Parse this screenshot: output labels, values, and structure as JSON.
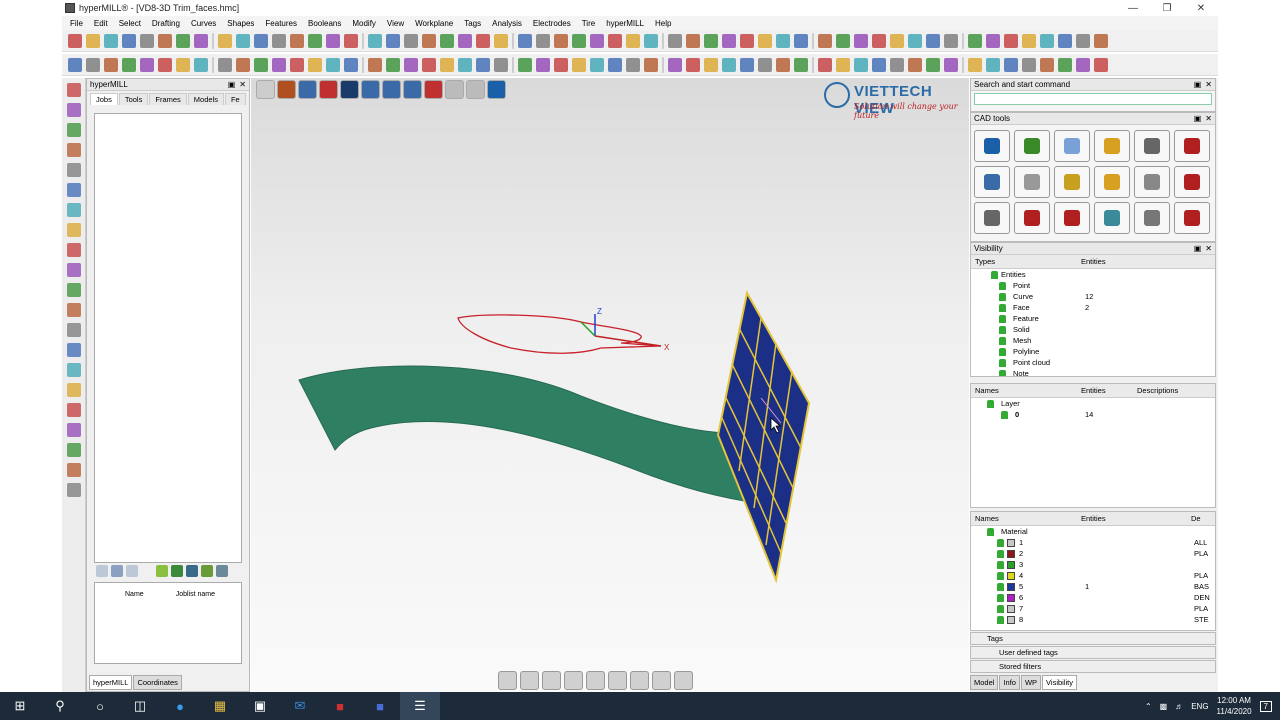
{
  "window": {
    "title": "hyperMILL® - [VD8-3D Trim_faces.hmc]",
    "minimize_icon": "minimize-icon",
    "maximize_icon": "maximize-icon",
    "close_icon": "close-icon"
  },
  "menu": [
    "File",
    "Edit",
    "Select",
    "Drafting",
    "Curves",
    "Shapes",
    "Features",
    "Booleans",
    "Modify",
    "View",
    "Workplane",
    "Tags",
    "Analysis",
    "Electrodes",
    "Tire",
    "hyperMILL",
    "Help"
  ],
  "left_panel": {
    "title": "hyperMILL",
    "tabs": [
      "Jobs",
      "Tools",
      "Frames",
      "Models",
      "Fe"
    ],
    "list_headers": [
      "Name",
      "Joblist name"
    ],
    "bottom_tabs": [
      "hyperMILL",
      "Coordinates"
    ]
  },
  "logo": {
    "name": "VIETTECH VIEW",
    "slogan": "Solution will change your future"
  },
  "axes": {
    "z": "Z",
    "x": "X"
  },
  "right_panel": {
    "search_title": "Search and start command",
    "cad_tools_title": "CAD tools",
    "cad_tool_colors": [
      "#1a5fa8",
      "#3a8a2a",
      "#7aa0d8",
      "#d8a020",
      "#666",
      "#b02020",
      "#3a6aa8",
      "#999",
      "#c8a020",
      "#d8a020",
      "#888",
      "#b02020",
      "#666",
      "#b02020",
      "#b02020",
      "#3a8a9a",
      "#777",
      "#b02020"
    ],
    "visibility_title": "Visibility",
    "vis_headers": [
      "Types",
      "Entities"
    ],
    "vis_rows": [
      {
        "name": "Entities",
        "count": ""
      },
      {
        "name": "Point",
        "count": ""
      },
      {
        "name": "Curve",
        "count": "12"
      },
      {
        "name": "Face",
        "count": "2"
      },
      {
        "name": "Feature",
        "count": ""
      },
      {
        "name": "Solid",
        "count": ""
      },
      {
        "name": "Mesh",
        "count": ""
      },
      {
        "name": "Polyline",
        "count": ""
      },
      {
        "name": "Point cloud",
        "count": ""
      },
      {
        "name": "Note",
        "count": ""
      }
    ],
    "layer_headers": [
      "Names",
      "Entities",
      "Descriptions"
    ],
    "layer_rows": [
      {
        "name": "Layer",
        "count": ""
      },
      {
        "name": "0",
        "count": "14"
      }
    ],
    "material_headers": [
      "Names",
      "Entities",
      "De"
    ],
    "material_rows": [
      {
        "name": "Material",
        "count": "",
        "desc": "",
        "color": ""
      },
      {
        "name": "1",
        "count": "",
        "desc": "ALL",
        "color": "#c8c8c8"
      },
      {
        "name": "2",
        "count": "",
        "desc": "PLA",
        "color": "#8b1a1a"
      },
      {
        "name": "3",
        "count": "",
        "desc": "",
        "color": "#2aa02a"
      },
      {
        "name": "4",
        "count": "",
        "desc": "PLA",
        "color": "#d8d820"
      },
      {
        "name": "5",
        "count": "1",
        "desc": "BAS",
        "color": "#1a3a9a"
      },
      {
        "name": "6",
        "count": "",
        "desc": "DEN",
        "color": "#b020c0"
      },
      {
        "name": "7",
        "count": "",
        "desc": "PLA",
        "color": "#c8c8c8"
      },
      {
        "name": "8",
        "count": "",
        "desc": "STE",
        "color": "#c8c8c8"
      }
    ],
    "bottom_rows": [
      "Tags",
      "User defined tags",
      "Stored filters"
    ],
    "tabs": [
      "Model",
      "Info",
      "WP",
      "Visibility"
    ]
  },
  "taskbar": {
    "lang": "ENG",
    "time": "12:00 AM",
    "date": "11/4/2020",
    "notifications": "7"
  }
}
